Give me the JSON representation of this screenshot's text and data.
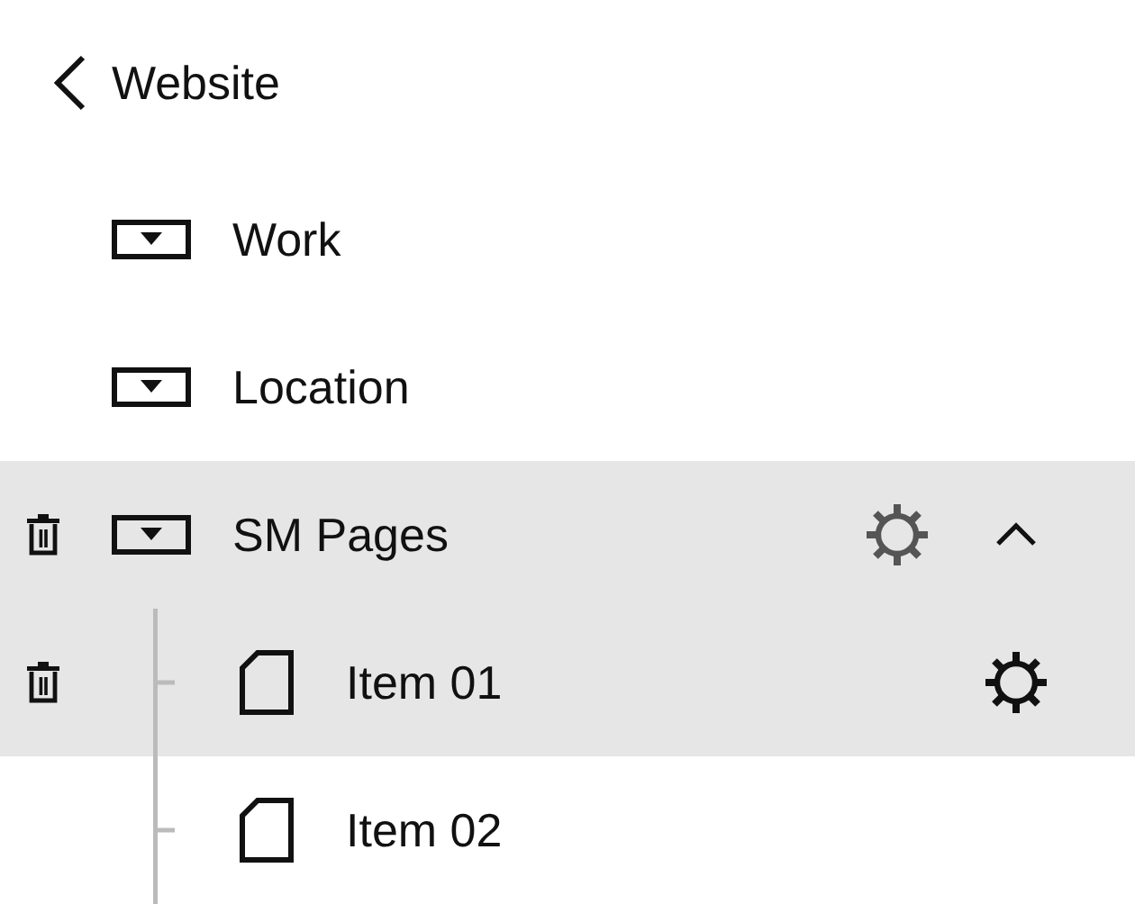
{
  "header": {
    "title": "Website"
  },
  "nav_items": [
    {
      "label": "Work",
      "kind": "folder",
      "hovered": false
    },
    {
      "label": "Location",
      "kind": "folder",
      "hovered": false
    },
    {
      "label": "SM Pages",
      "kind": "folder",
      "hovered": true,
      "expanded": true,
      "children": [
        {
          "label": "Item 01",
          "kind": "page",
          "hovered": true
        },
        {
          "label": "Item 02",
          "kind": "page",
          "hovered": false
        }
      ]
    }
  ]
}
